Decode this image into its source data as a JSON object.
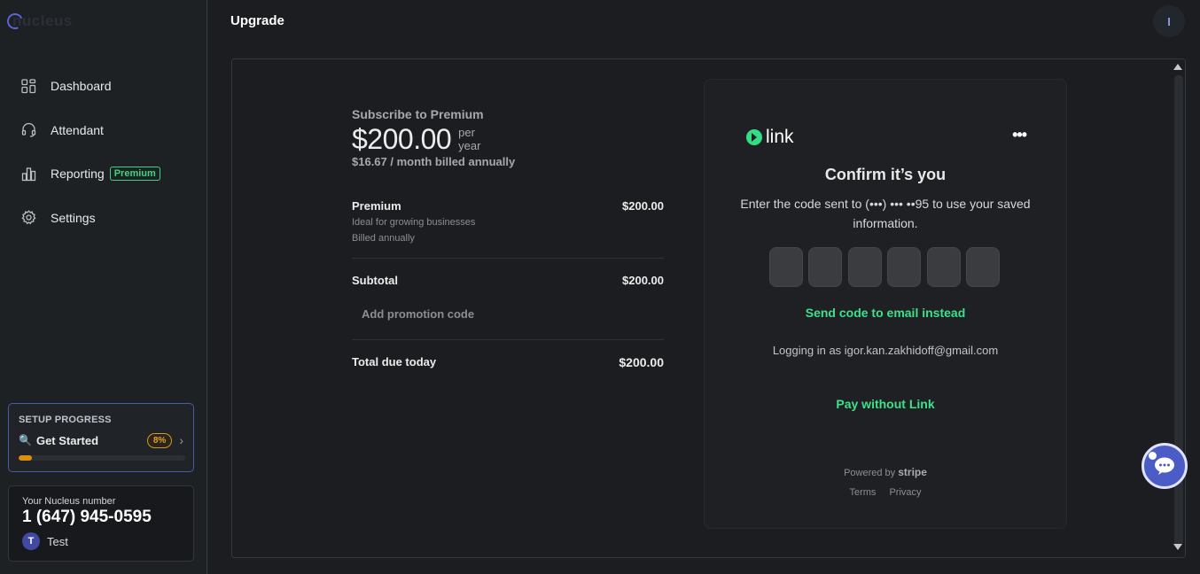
{
  "app": {
    "logo_text": "nucleus"
  },
  "sidebar": {
    "items": [
      {
        "label": "Dashboard",
        "icon": "grid-icon"
      },
      {
        "label": "Attendant",
        "icon": "headset-icon"
      },
      {
        "label": "Reporting",
        "icon": "bar-chart-icon",
        "badge": "Premium"
      },
      {
        "label": "Settings",
        "icon": "gear-icon"
      }
    ],
    "setup": {
      "title": "SETUP PROGRESS",
      "label": "Get Started",
      "percent_label": "8%",
      "progress": 0.08
    },
    "number_box": {
      "label": "Your Nucleus number",
      "number": "1 (647) 945-0595",
      "user_initial": "T",
      "user_name": "Test"
    }
  },
  "header": {
    "title": "Upgrade",
    "avatar_initial": "I"
  },
  "summary": {
    "subscribe_title": "Subscribe to Premium",
    "price": "$200.00",
    "per_line1": "per",
    "per_line2": "year",
    "monthly": "$16.67 / month billed annually",
    "item_name": "Premium",
    "item_desc1": "Ideal for growing businesses",
    "item_desc2": "Billed annually",
    "item_amount": "$200.00",
    "subtotal_label": "Subtotal",
    "subtotal_amount": "$200.00",
    "promo_label": "Add promotion code",
    "total_label": "Total due today",
    "total_amount": "$200.00"
  },
  "link_panel": {
    "brand": "link",
    "more": "•••",
    "title": "Confirm it’s you",
    "instructions": "Enter the code sent to (•••) ••• ••95 to use your saved information.",
    "code_length": 6,
    "send_email": "Send code to email instead",
    "logging_in": "Logging in as igor.kan.zakhidoff@gmail.com",
    "pay_without": "Pay without Link",
    "powered_by": "Powered by",
    "powered_brand": "stripe",
    "terms": "Terms",
    "privacy": "Privacy"
  },
  "colors": {
    "accent_green": "#3ee08a",
    "brand_blue": "#4b5cc7",
    "progress_orange": "#d9900d"
  }
}
